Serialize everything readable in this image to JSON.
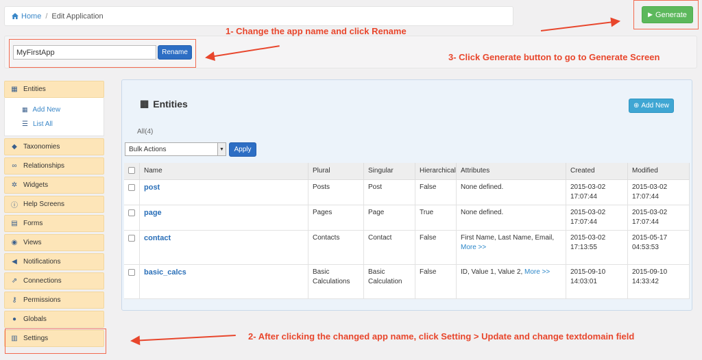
{
  "breadcrumb": {
    "home": "Home",
    "separator": "/",
    "current": "Edit Application"
  },
  "generate_button": "Generate",
  "rename": {
    "app_name": "MyFirstApp",
    "button": "Rename"
  },
  "annotations": {
    "step1": "1- Change the app name and click Rename",
    "step2": "2- After clicking the changed app name, click Setting > Update and change textdomain field",
    "step3": "3- Click Generate button to go to Generate Screen"
  },
  "sidebar": {
    "entities": "Entities",
    "sub": {
      "add_new": "Add New",
      "list_all": "List All"
    },
    "items": [
      "Taxonomies",
      "Relationships",
      "Widgets",
      "Help Screens",
      "Forms",
      "Views",
      "Notifications",
      "Connections",
      "Permissions",
      "Globals",
      "Settings"
    ]
  },
  "main": {
    "title": "Entities",
    "add_new": "Add New",
    "all_count": "All(4)",
    "bulk_select": "Bulk Actions",
    "apply": "Apply",
    "columns": [
      "Name",
      "Plural",
      "Singular",
      "Hierarchical",
      "Attributes",
      "Created",
      "Modified"
    ],
    "rows": [
      {
        "name": "post",
        "plural": "Posts",
        "singular": "Post",
        "hierarchical": "False",
        "attributes": "None defined.",
        "more": "",
        "created": "2015-03-02 17:07:44",
        "modified": "2015-03-02 17:07:44"
      },
      {
        "name": "page",
        "plural": "Pages",
        "singular": "Page",
        "hierarchical": "True",
        "attributes": "None defined.",
        "more": "",
        "created": "2015-03-02 17:07:44",
        "modified": "2015-03-02 17:07:44"
      },
      {
        "name": "contact",
        "plural": "Contacts",
        "singular": "Contact",
        "hierarchical": "False",
        "attributes": "First Name, Last Name, Email,",
        "more": "More >>",
        "created": "2015-03-02 17:13:55",
        "modified": "2015-05-17 04:53:53"
      },
      {
        "name": "basic_calcs",
        "plural": "Basic Calculations",
        "singular": "Basic Calculation",
        "hierarchical": "False",
        "attributes": "ID, Value 1, Value 2,",
        "more": "More >>",
        "created": "2015-09-10 14:03:01",
        "modified": "2015-09-10 14:33:42"
      }
    ]
  }
}
